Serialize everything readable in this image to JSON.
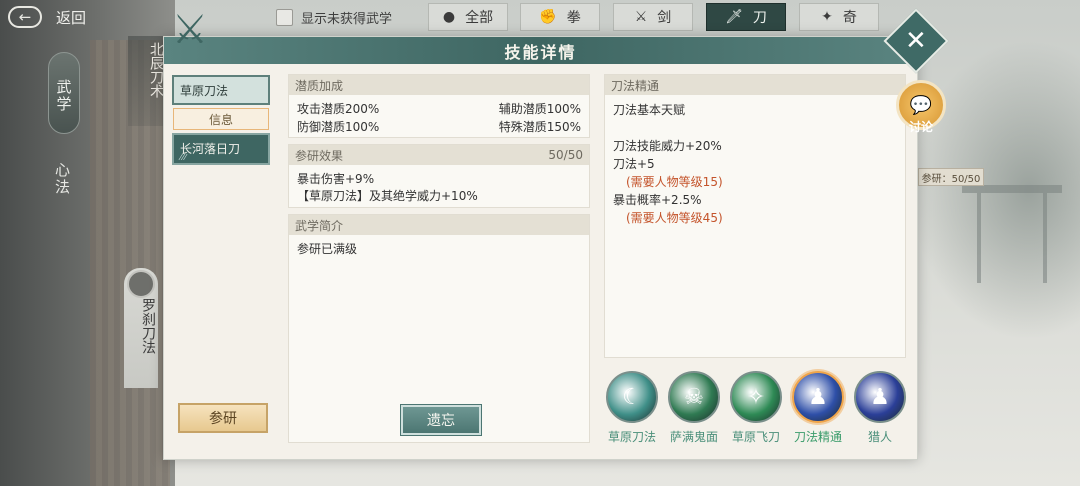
{
  "topbar": {
    "back_label": "返回",
    "back_icon": "arrow-left-icon",
    "show_unobtained_label": "显示未获得武学",
    "show_unobtained_checked": false,
    "categories": [
      {
        "label": "全部",
        "icon": "bag-icon",
        "active": false
      },
      {
        "label": "拳",
        "icon": "fist-icon",
        "active": false
      },
      {
        "label": "剑",
        "icon": "sword-icon",
        "active": false
      },
      {
        "label": "刀",
        "icon": "blade-icon",
        "active": true
      },
      {
        "label": "奇",
        "icon": "shuriken-icon",
        "active": false
      }
    ]
  },
  "left_nav": {
    "wuxue": "武学",
    "xinfa": "心法",
    "book1": "北辰刀术",
    "book2": "罗刹刀法"
  },
  "right_side": {
    "discuss_label": "讨论",
    "research_badge": "参研：50/50"
  },
  "modal": {
    "title": "技能详情",
    "skill_list": [
      {
        "name": "草原刀法",
        "selected": true
      },
      {
        "name": "长河落日刀",
        "selected": false
      }
    ],
    "info_tab": "信息",
    "research_button": "参研",
    "forget_button": "遗忘",
    "potential": {
      "header": "潜质加成",
      "items": [
        "攻击潜质200%",
        "辅助潜质100%",
        "防御潜质100%",
        "特殊潜质150%"
      ]
    },
    "research_effect": {
      "header": "参研效果",
      "progress": "50/50",
      "lines": [
        "暴击伤害+9%",
        "【草原刀法】及其绝学威力+10%"
      ]
    },
    "intro": {
      "header": "武学简介",
      "text": "参研已满级"
    },
    "mastery": {
      "header": "刀法精通",
      "lines": [
        {
          "text": "刀法基本天赋",
          "type": "normal"
        },
        {
          "text": "",
          "type": "gap"
        },
        {
          "text": "刀法技能威力+20%",
          "type": "normal"
        },
        {
          "text": "刀法+5",
          "type": "normal"
        },
        {
          "text": "(需要人物等级15)",
          "type": "req"
        },
        {
          "text": "暴击概率+2.5%",
          "type": "normal"
        },
        {
          "text": "(需要人物等级45)",
          "type": "req"
        }
      ]
    },
    "skill_icons": [
      {
        "name": "草原刀法",
        "color": "#3f8f88",
        "text_color": "#3f7f78",
        "icon": "crescent-blade-icon",
        "selected": false
      },
      {
        "name": "萨满鬼面",
        "color": "#2f7a52",
        "text_color": "#3f7f78",
        "icon": "demon-mask-icon",
        "selected": false
      },
      {
        "name": "草原飞刀",
        "color": "#2e8a55",
        "text_color": "#3f7f78",
        "icon": "flying-knife-icon",
        "selected": false
      },
      {
        "name": "刀法精通",
        "color": "#2e4fa8",
        "text_color": "#3f7f78",
        "icon": "mastery-figure-icon",
        "selected": true
      },
      {
        "name": "猎人",
        "color": "#2b3f98",
        "text_color": "#3f7f78",
        "icon": "hunter-figure-icon",
        "selected": false
      }
    ]
  }
}
